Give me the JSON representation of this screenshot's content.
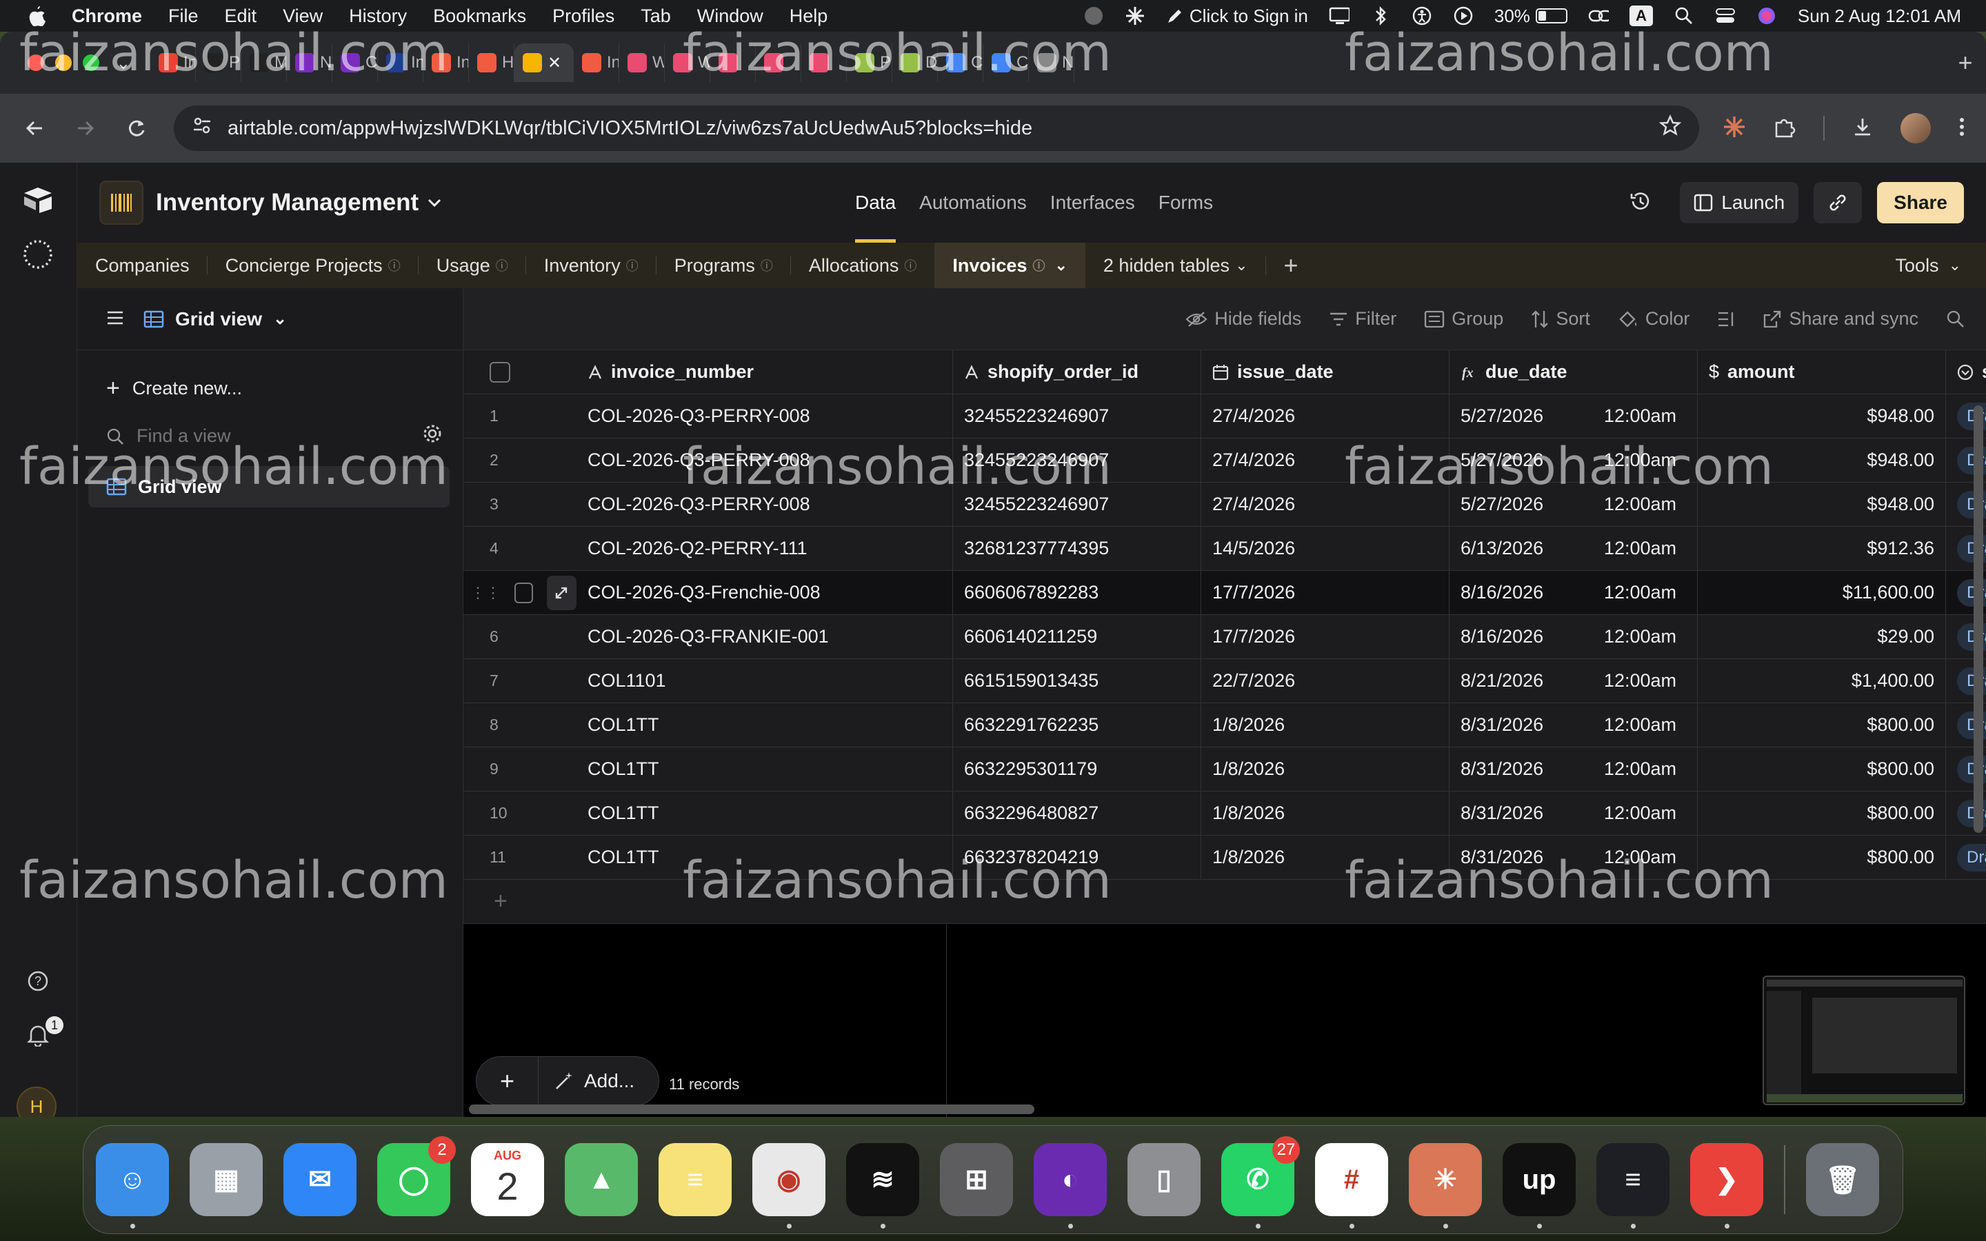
{
  "menubar": {
    "app": "Chrome",
    "items": [
      "File",
      "Edit",
      "View",
      "History",
      "Bookmarks",
      "Profiles",
      "Tab",
      "Window",
      "Help"
    ],
    "click_to_sign_in": "Click to Sign in",
    "battery": "30%",
    "battery_level": 0.3,
    "input_source": "A",
    "datetime": "Sun 2 Aug  12:01 AM"
  },
  "browser": {
    "tabs": [
      {
        "label": "Int",
        "icon": "gmail-icon",
        "color": "#ea4335"
      },
      {
        "label": "Pro",
        "icon": "upwork-icon",
        "color": "#222"
      },
      {
        "label": "Me",
        "icon": "upwork-icon",
        "color": "#222"
      },
      {
        "label": "Ne",
        "icon": "make-icon",
        "color": "#7b2cbf"
      },
      {
        "label": "Cu",
        "icon": "make-icon",
        "color": "#7b2cbf"
      },
      {
        "label": "Inv",
        "icon": "site-icon",
        "color": "#1d3f8f"
      },
      {
        "label": "Inv",
        "icon": "airtable-icon",
        "color": "#f15b42"
      },
      {
        "label": "Ho",
        "icon": "airtable-icon",
        "color": "#f15b42"
      },
      {
        "label": "",
        "icon": "airtable-icon",
        "color": "#f7b500"
      },
      {
        "label": "Int",
        "icon": "airtable-icon",
        "color": "#f15b42"
      },
      {
        "label": "Wo",
        "icon": "n8n-icon",
        "color": "#ea4b71"
      },
      {
        "label": "Wo",
        "icon": "n8n-icon",
        "color": "#ea4b71"
      },
      {
        "label": "",
        "icon": "n8n-icon",
        "color": "#ea4b71"
      },
      {
        "label": "",
        "icon": "n8n-icon",
        "color": "#ea4b71"
      },
      {
        "label": "",
        "icon": "n8n-icon",
        "color": "#ea4b71"
      },
      {
        "label": "Pla",
        "icon": "shopify-icon",
        "color": "#95bf47"
      },
      {
        "label": "Di",
        "icon": "shopify-icon",
        "color": "#95bf47"
      },
      {
        "label": "Co",
        "icon": "docs-icon",
        "color": "#4285f4"
      },
      {
        "label": "Co",
        "icon": "docs-icon",
        "color": "#4285f4"
      },
      {
        "label": "Ne",
        "icon": "chrome-icon",
        "color": "#888"
      }
    ],
    "url": "airtable.com/appwHwjzslWDKLWqr/tblCiVIOX5MrtIOLz/viw6zs7aUcUedwAu5?blocks=hide"
  },
  "base": {
    "name": "Inventory Management",
    "nav": [
      "Data",
      "Automations",
      "Interfaces",
      "Forms"
    ],
    "launch": "Launch",
    "share": "Share"
  },
  "tables": {
    "items": [
      "Companies",
      "Concierge Projects",
      "Usage",
      "Inventory",
      "Programs",
      "Allocations",
      "Invoices"
    ],
    "hidden": "2 hidden tables",
    "tools": "Tools"
  },
  "sidebar": {
    "view_name": "Grid view",
    "create_new": "Create new...",
    "find_placeholder": "Find a view",
    "current_view": "Grid view"
  },
  "viewbar": {
    "hide_fields": "Hide fields",
    "filter": "Filter",
    "group": "Group",
    "sort": "Sort",
    "color": "Color",
    "share_sync": "Share and sync"
  },
  "grid": {
    "columns": [
      "invoice_number",
      "shopify_order_id",
      "issue_date",
      "due_date",
      "amount",
      "st"
    ],
    "rows": [
      {
        "n": "1",
        "invoice": "COL-2026-Q3-PERRY-008",
        "shopify": "32455223246907",
        "issue": "27/4/2026",
        "due": "5/27/2026",
        "time": "12:00am",
        "amount": "$948.00",
        "status": "Dra"
      },
      {
        "n": "2",
        "invoice": "COL-2026-Q3-PERRY-008",
        "shopify": "32455223246907",
        "issue": "27/4/2026",
        "due": "5/27/2026",
        "time": "12:00am",
        "amount": "$948.00",
        "status": "Dra"
      },
      {
        "n": "3",
        "invoice": "COL-2026-Q3-PERRY-008",
        "shopify": "32455223246907",
        "issue": "27/4/2026",
        "due": "5/27/2026",
        "time": "12:00am",
        "amount": "$948.00",
        "status": "Dra"
      },
      {
        "n": "4",
        "invoice": "COL-2026-Q2-PERRY-111",
        "shopify": "32681237774395",
        "issue": "14/5/2026",
        "due": "6/13/2026",
        "time": "12:00am",
        "amount": "$912.36",
        "status": "Dra"
      },
      {
        "n": "",
        "invoice": "COL-2026-Q3-Frenchie-008",
        "shopify": "6606067892283",
        "issue": "17/7/2026",
        "due": "8/16/2026",
        "time": "12:00am",
        "amount": "$11,600.00",
        "status": "Dra"
      },
      {
        "n": "6",
        "invoice": "COL-2026-Q3-FRANKIE-001",
        "shopify": "6606140211259",
        "issue": "17/7/2026",
        "due": "8/16/2026",
        "time": "12:00am",
        "amount": "$29.00",
        "status": "Dra"
      },
      {
        "n": "7",
        "invoice": "COL1101",
        "shopify": "6615159013435",
        "issue": "22/7/2026",
        "due": "8/21/2026",
        "time": "12:00am",
        "amount": "$1,400.00",
        "status": "Dra"
      },
      {
        "n": "8",
        "invoice": "COL1TT",
        "shopify": "6632291762235",
        "issue": "1/8/2026",
        "due": "8/31/2026",
        "time": "12:00am",
        "amount": "$800.00",
        "status": "Dra"
      },
      {
        "n": "9",
        "invoice": "COL1TT",
        "shopify": "6632295301179",
        "issue": "1/8/2026",
        "due": "8/31/2026",
        "time": "12:00am",
        "amount": "$800.00",
        "status": "Dra"
      },
      {
        "n": "10",
        "invoice": "COL1TT",
        "shopify": "6632296480827",
        "issue": "1/8/2026",
        "due": "8/31/2026",
        "time": "12:00am",
        "amount": "$800.00",
        "status": "Dra"
      },
      {
        "n": "11",
        "invoice": "COL1TT",
        "shopify": "6632378204219",
        "issue": "1/8/2026",
        "due": "8/31/2026",
        "time": "12:00am",
        "amount": "$800.00",
        "status": "Dra"
      }
    ],
    "add_label": "Add...",
    "records": "11 records"
  },
  "rail": {
    "notifications": "1",
    "user_initial": "H"
  },
  "dock": {
    "apps": [
      {
        "name": "finder-icon",
        "bg": "#3b8ee8",
        "glyph": "☺",
        "badge": "",
        "running": true
      },
      {
        "name": "launchpad-icon",
        "bg": "#9aa0a8",
        "glyph": "▦",
        "badge": "",
        "running": false
      },
      {
        "name": "mail-icon",
        "bg": "#2f86f6",
        "glyph": "✉",
        "badge": "",
        "running": false
      },
      {
        "name": "messages-icon",
        "bg": "#34c759",
        "glyph": "◯",
        "badge": "2",
        "running": false
      },
      {
        "name": "calendar-icon",
        "bg": "#ffffff",
        "glyph": "2",
        "badge": "",
        "running": false
      },
      {
        "name": "maps-icon",
        "bg": "#58b96a",
        "glyph": "▲",
        "badge": "",
        "running": false
      },
      {
        "name": "notes-icon",
        "bg": "#f7e27a",
        "glyph": "≡",
        "badge": "",
        "running": false
      },
      {
        "name": "chrome-icon",
        "bg": "#e8e8e8",
        "glyph": "◉",
        "badge": "",
        "running": true
      },
      {
        "name": "spotify-icon",
        "bg": "#121212",
        "glyph": "≋",
        "badge": "",
        "running": true
      },
      {
        "name": "calculator-icon",
        "bg": "#5d5d60",
        "glyph": "⊞",
        "badge": "",
        "running": false
      },
      {
        "name": "firefox-icon",
        "bg": "#6a2bb0",
        "glyph": "◐",
        "badge": "",
        "running": true
      },
      {
        "name": "iphone-mirroring-icon",
        "bg": "#8d8f93",
        "glyph": "▯",
        "badge": "",
        "running": false
      },
      {
        "name": "whatsapp-icon",
        "bg": "#25d366",
        "glyph": "✆",
        "badge": "27",
        "running": true
      },
      {
        "name": "slack-icon",
        "bg": "#ffffff",
        "glyph": "#",
        "badge": "",
        "running": true
      },
      {
        "name": "claude-icon",
        "bg": "#d97757",
        "glyph": "✳",
        "badge": "",
        "running": true
      },
      {
        "name": "upwork-icon",
        "bg": "#111111",
        "glyph": "up",
        "badge": "",
        "running": true
      },
      {
        "name": "linear-icon",
        "bg": "#1e1f24",
        "glyph": "≡",
        "badge": "",
        "running": true
      },
      {
        "name": "anydesk-icon",
        "bg": "#e8423a",
        "glyph": "❯",
        "badge": "",
        "running": true
      },
      {
        "name": "trash-icon",
        "bg": "#6b6f76",
        "glyph": "🗑",
        "badge": "",
        "running": false
      }
    ],
    "calendar_month": "AUG"
  },
  "watermark": "faizansohail.com"
}
